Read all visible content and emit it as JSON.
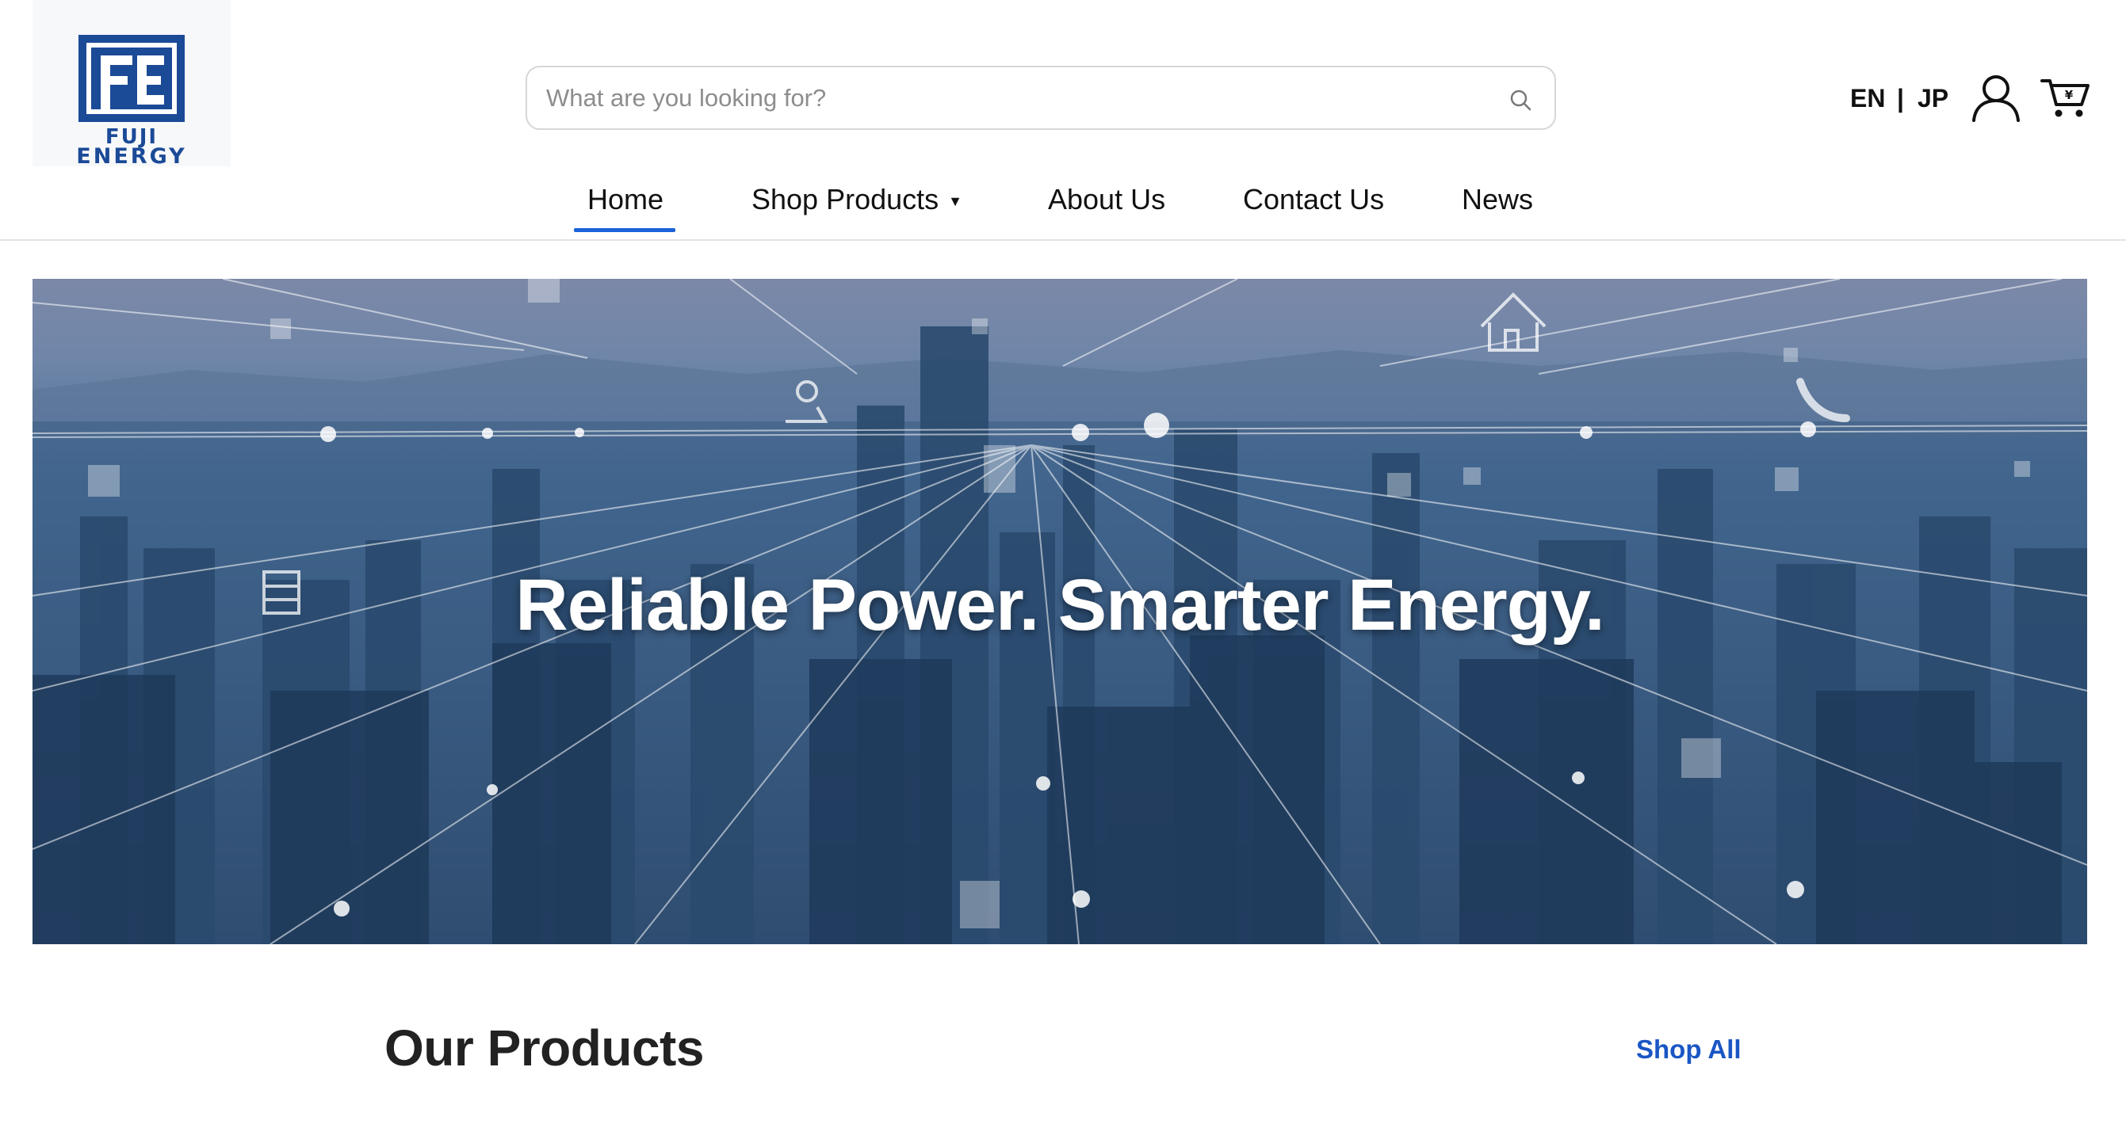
{
  "brand": {
    "logo_line1": "FUJI",
    "logo_line2": "ENERGY",
    "color": "#1b4a97"
  },
  "search": {
    "placeholder": "What are you looking for?",
    "value": "",
    "icon": "search-icon"
  },
  "language": {
    "en": "EN",
    "separator": "|",
    "jp": "JP"
  },
  "account": {
    "icon": "user-icon"
  },
  "cart": {
    "icon": "cart-icon"
  },
  "nav": {
    "home": "Home",
    "shop_products": "Shop Products",
    "shop_caret": "▼",
    "about": "About Us",
    "contact": "Contact Us",
    "news": "News",
    "active": "Home",
    "accent": "#1a63d8"
  },
  "hero": {
    "title": "Reliable Power. Smarter Energy."
  },
  "products": {
    "title": "Our Products",
    "shop_all": "Shop All",
    "link_color": "#1a56c4"
  }
}
